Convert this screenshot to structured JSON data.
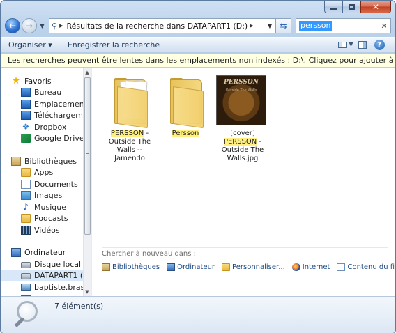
{
  "window": {
    "caption_buttons": [
      "minimize",
      "maximize",
      "close"
    ]
  },
  "address": {
    "path": "Résultats de la recherche dans DATAPART1 (D:)"
  },
  "search": {
    "query": "persson"
  },
  "toolbar": {
    "organize_label": "Organiser ▾",
    "save_search_label": "Enregistrer la recherche"
  },
  "infobar": {
    "message": "Les recherches peuvent être lentes dans les emplacements non indexés : D:\\. Cliquez pour ajouter à l'index..."
  },
  "nav": {
    "favorites": {
      "label": "Favoris",
      "items": [
        "Bureau",
        "Emplacements r",
        "Téléchargement",
        "Dropbox",
        "Google Drive"
      ]
    },
    "libraries": {
      "label": "Bibliothèques",
      "items": [
        "Apps",
        "Documents",
        "Images",
        "Musique",
        "Podcasts",
        "Vidéos"
      ]
    },
    "computer": {
      "label": "Ordinateur",
      "items": [
        "Disque local (C:)",
        "DATAPART1 (D:)",
        "baptiste.brassart",
        "..."
      ]
    }
  },
  "results": [
    {
      "pre": "",
      "hl": "PERSSON",
      "post": " - Outside The Walls -- Jamendo",
      "kind": "folder-with-files"
    },
    {
      "pre": "",
      "hl": "Persson",
      "post": "",
      "kind": "folder"
    },
    {
      "pre": "[cover] ",
      "hl": "PERSSON",
      "post": " - Outside The Walls.jpg",
      "kind": "image",
      "cover_title": "PERSSON",
      "cover_sub": "Outside The Walls"
    }
  ],
  "search_again": {
    "title": "Chercher à nouveau dans :",
    "items": [
      "Bibliothèques",
      "Ordinateur",
      "Personnaliser...",
      "Internet",
      "Contenu du fichier"
    ]
  },
  "status": {
    "count": "7 élément(s)"
  }
}
